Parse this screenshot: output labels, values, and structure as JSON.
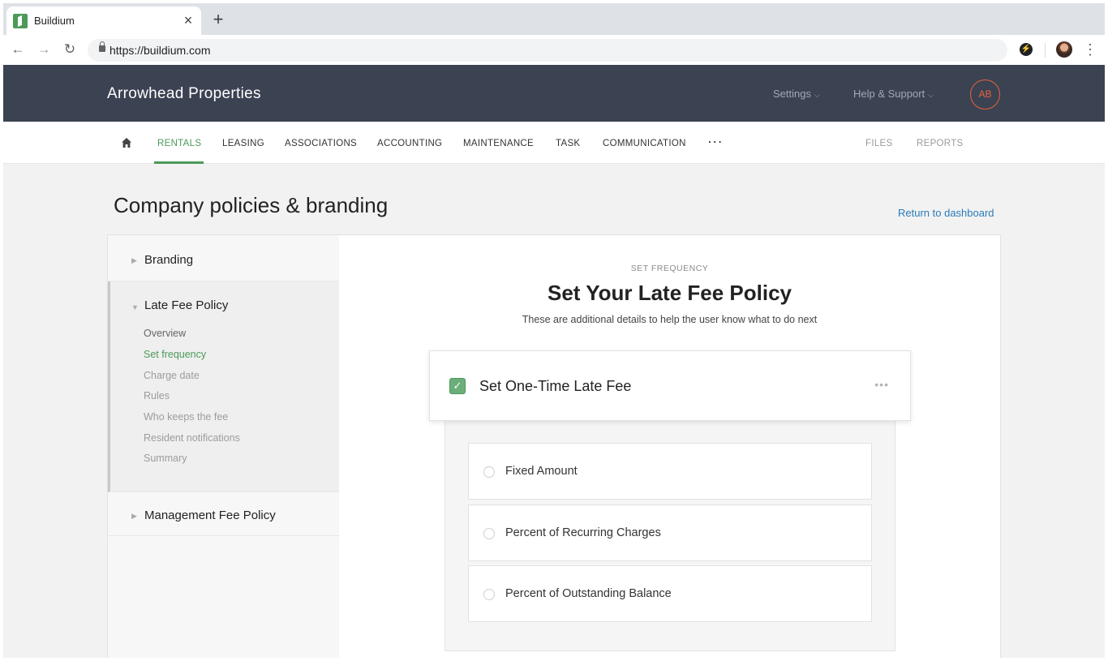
{
  "browser": {
    "tab_title": "Buildium",
    "url": "https://buildium.com"
  },
  "header": {
    "brand": "Arrowhead Properties",
    "settings_label": "Settings",
    "help_label": "Help & Support",
    "avatar_initials": "AB"
  },
  "nav": {
    "items": [
      "RENTALS",
      "LEASING",
      "ASSOCIATIONS",
      "ACCOUNTING",
      "MAINTENANCE",
      "TASK",
      "COMMUNICATION"
    ],
    "more": "···",
    "right_items": [
      "FILES",
      "REPORTS"
    ],
    "active": "RENTALS"
  },
  "page": {
    "title": "Company policies & branding",
    "return_link": "Return to dashboard"
  },
  "sidebar": {
    "branding": "Branding",
    "late_fee": "Late Fee Policy",
    "sub_items": [
      "Overview",
      "Set frequency",
      "Charge date",
      "Rules",
      "Who keeps the fee",
      "Resident notifications",
      "Summary"
    ],
    "current_sub_item": "Set frequency",
    "management_fee": "Management Fee Policy"
  },
  "content": {
    "eyebrow": "SET FREQUENCY",
    "headline": "Set Your Late Fee Policy",
    "subtext": "These are additional details to help the user know what to do next",
    "card_title": "Set One-Time Late Fee",
    "card_checked": true,
    "options": [
      "Fixed Amount",
      "Percent of Recurring Charges",
      "Percent of Outstanding Balance"
    ]
  },
  "colors": {
    "accent_green": "#4c9a5a",
    "header_bg": "#3b4252",
    "avatar_orange": "#e8623b",
    "link_blue": "#2b7bb9"
  },
  "icons": [
    "tab-favicon-icon",
    "close-icon",
    "plus-icon",
    "back-icon",
    "forward-icon",
    "reload-icon",
    "lock-icon",
    "extension-icon",
    "profile-icon",
    "menu-icon",
    "home-icon",
    "chevron-down-icon",
    "triangle-right-icon",
    "triangle-down-icon",
    "checkmark-icon",
    "more-icon"
  ]
}
